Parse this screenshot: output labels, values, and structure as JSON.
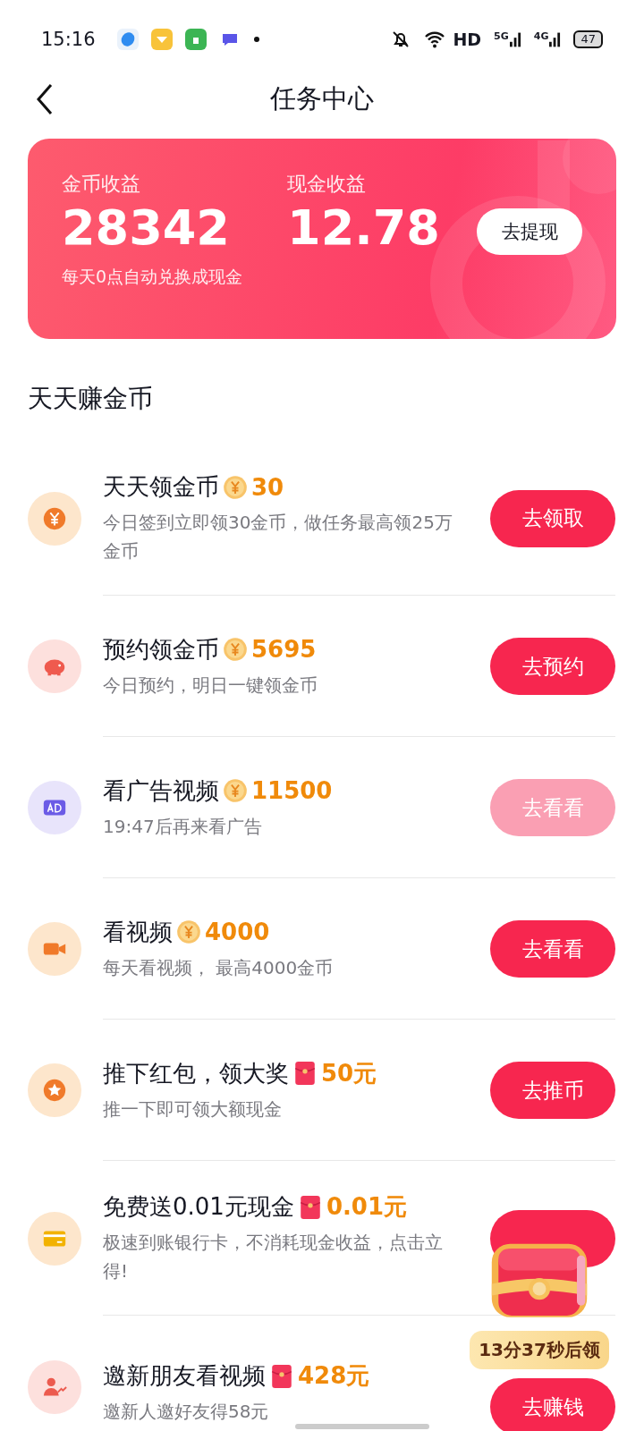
{
  "status_bar": {
    "time": "15:16",
    "network": "HD",
    "signal_1": "5G",
    "signal_2": "4G",
    "battery": "47"
  },
  "header": {
    "title": "任务中心"
  },
  "earnings": {
    "coins": {
      "label": "金币收益",
      "value": "28342"
    },
    "note": "每天0点自动兑换成现金",
    "cash": {
      "label": "现金收益",
      "value": "12.78"
    },
    "button": "去提现"
  },
  "section": {
    "title": "天天赚金币"
  },
  "tasks": [
    {
      "kind": "coin",
      "title": "天天领金币",
      "reward": "30",
      "subtitle": "今日签到立即领30金币，做任务最高领25万金币",
      "button": "去领取",
      "disabled": false
    },
    {
      "kind": "coin",
      "title": "预约领金币",
      "reward": "5695",
      "subtitle": "今日预约，明日一键领金币",
      "button": "去预约",
      "disabled": false
    },
    {
      "kind": "coin",
      "title": "看广告视频",
      "reward": "11500",
      "subtitle": "19:47后再来看广告",
      "button": "去看看",
      "disabled": true
    },
    {
      "kind": "coin",
      "title": "看视频",
      "reward": "4000",
      "subtitle": "每天看视频， 最高4000金币",
      "button": "去看看",
      "disabled": false
    },
    {
      "kind": "cash",
      "title": "推下红包，领大奖",
      "reward": "50元",
      "subtitle": "推一下即可领大额现金",
      "button": "去推币",
      "disabled": false
    },
    {
      "kind": "cash",
      "title": "免费送0.01元现金",
      "reward": "0.01元",
      "subtitle": "极速到账银行卡，不消耗现金收益，点击立得!",
      "disabled": false
    },
    {
      "kind": "cash",
      "title": "邀新朋友看视频",
      "reward": "428元",
      "subtitle": "邀新人邀好友得58元",
      "button": "去赚钱",
      "disabled": false
    }
  ],
  "floating_chest": {
    "countdown": "13分37秒后领"
  }
}
